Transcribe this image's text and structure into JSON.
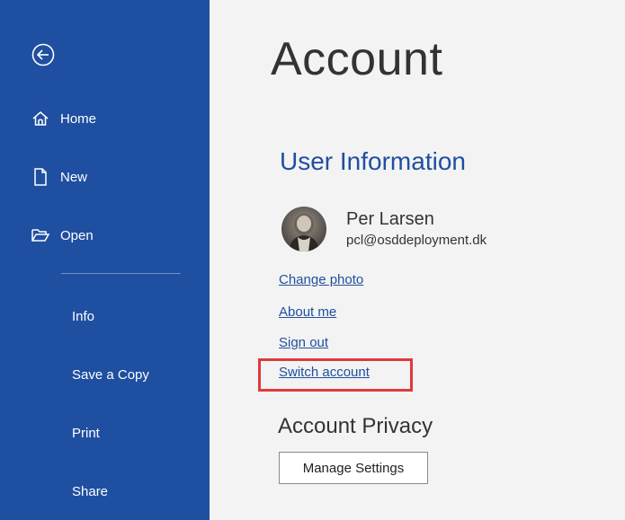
{
  "sidebar": {
    "back_icon": "back-arrow-icon",
    "items": [
      {
        "label": "Home",
        "icon": "home-icon"
      },
      {
        "label": "New",
        "icon": "new-document-icon"
      },
      {
        "label": "Open",
        "icon": "folder-open-icon"
      },
      {
        "label": "Info"
      },
      {
        "label": "Save a Copy"
      },
      {
        "label": "Print"
      },
      {
        "label": "Share"
      }
    ]
  },
  "main": {
    "title": "Account",
    "user_info": {
      "heading": "User Information",
      "name": "Per Larsen",
      "email": "pcl@osddeployment.dk",
      "links": [
        "Change photo",
        "About me",
        "Sign out",
        "Switch account"
      ]
    },
    "privacy": {
      "heading": "Account Privacy",
      "button": "Manage Settings"
    }
  },
  "colors": {
    "sidebar_bg": "#1f4fa0",
    "accent": "#1f4fa0",
    "highlight": "#e13a3a",
    "content_bg": "#f3f3f3"
  }
}
